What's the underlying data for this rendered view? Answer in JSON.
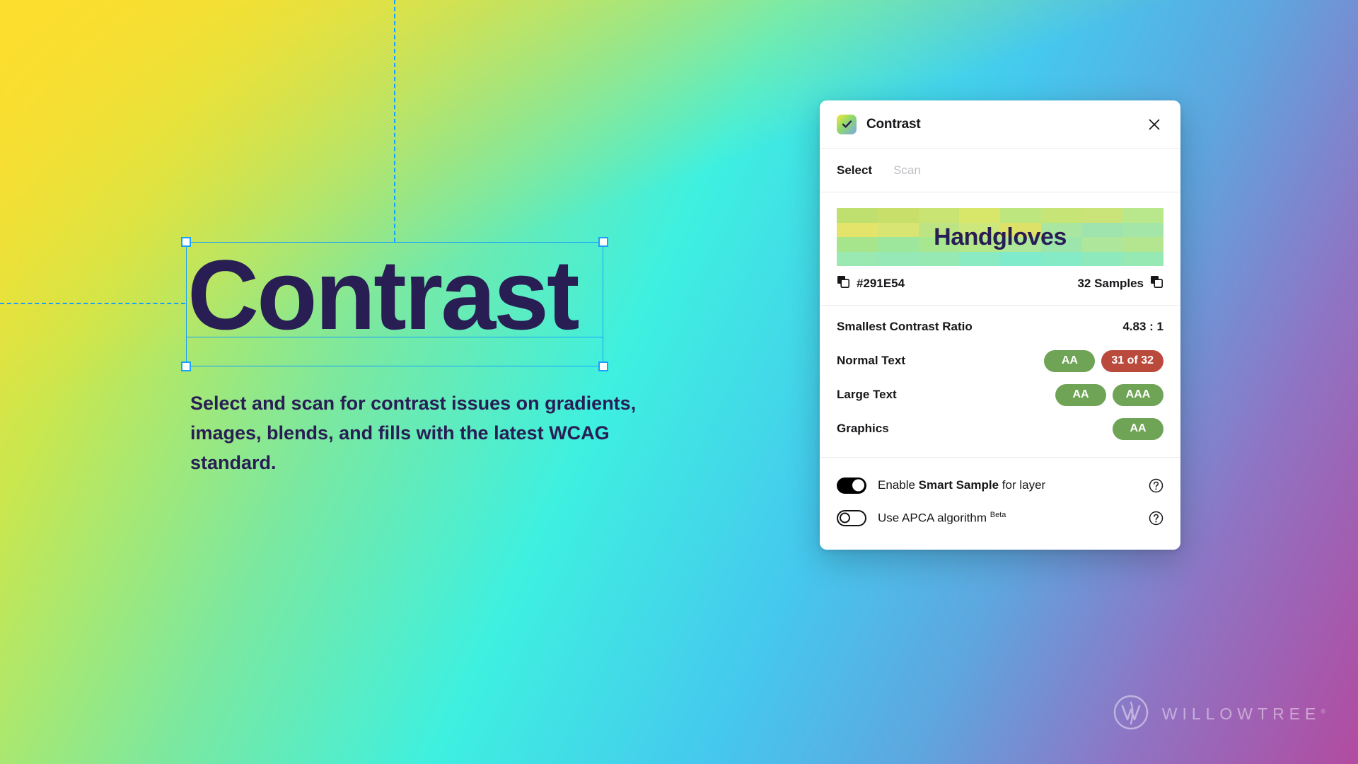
{
  "canvas": {
    "hero_title": "Contrast",
    "hero_body": "Select and scan for contrast issues on gradients, images, blends, and fills with the latest WCAG standard.",
    "text_color": "#291E54",
    "selection_color": "#18A0FB"
  },
  "panel": {
    "title": "Contrast",
    "close_label": "✕",
    "tabs": [
      {
        "label": "Select",
        "active": true
      },
      {
        "label": "Scan",
        "active": false
      }
    ],
    "sample": {
      "preview_text": "Handgloves",
      "hex": "#291E54",
      "samples_count": "32 Samples",
      "swatch_colors": [
        "#BFE06E",
        "#C8E06A",
        "#C9E472",
        "#D8E76A",
        "#BEE67F",
        "#C6E576",
        "#CBE47A",
        "#B9E78C",
        "#E4E36A",
        "#D8E572",
        "#BCE482",
        "#CCE77B",
        "#DDE167",
        "#A9E6A0",
        "#9FE4AE",
        "#A4E5A8",
        "#A7E58C",
        "#9CE79B",
        "#A8E690",
        "#B4E788",
        "#ADE79A",
        "#9DE6AB",
        "#AEE69C",
        "#B4E690",
        "#9AE8B2",
        "#96E9B6",
        "#97E9B3",
        "#8AEAC2",
        "#80EBCA",
        "#85EBC6",
        "#8EEABD",
        "#97E9B4"
      ]
    },
    "results": [
      {
        "label": "Smallest Contrast Ratio",
        "value": "4.83 : 1"
      },
      {
        "label": "Normal Text",
        "pills": [
          {
            "text": "AA",
            "color": "#6FA355"
          },
          {
            "text": "31 of 32",
            "color": "#B94A3C"
          }
        ]
      },
      {
        "label": "Large Text",
        "pills": [
          {
            "text": "AA",
            "color": "#6FA355"
          },
          {
            "text": "AAA",
            "color": "#6FA355"
          }
        ]
      },
      {
        "label": "Graphics",
        "pills": [
          {
            "text": "AA",
            "color": "#6FA355"
          }
        ]
      }
    ],
    "settings": [
      {
        "prefix": "Enable ",
        "strong": "Smart Sample",
        "suffix": " for layer",
        "badge": "",
        "enabled": true
      },
      {
        "prefix": "Use APCA algorithm",
        "strong": "",
        "suffix": "",
        "badge": "Beta",
        "enabled": false
      }
    ]
  },
  "brand": {
    "name": "WILLOWTREE",
    "trademark": "®"
  }
}
